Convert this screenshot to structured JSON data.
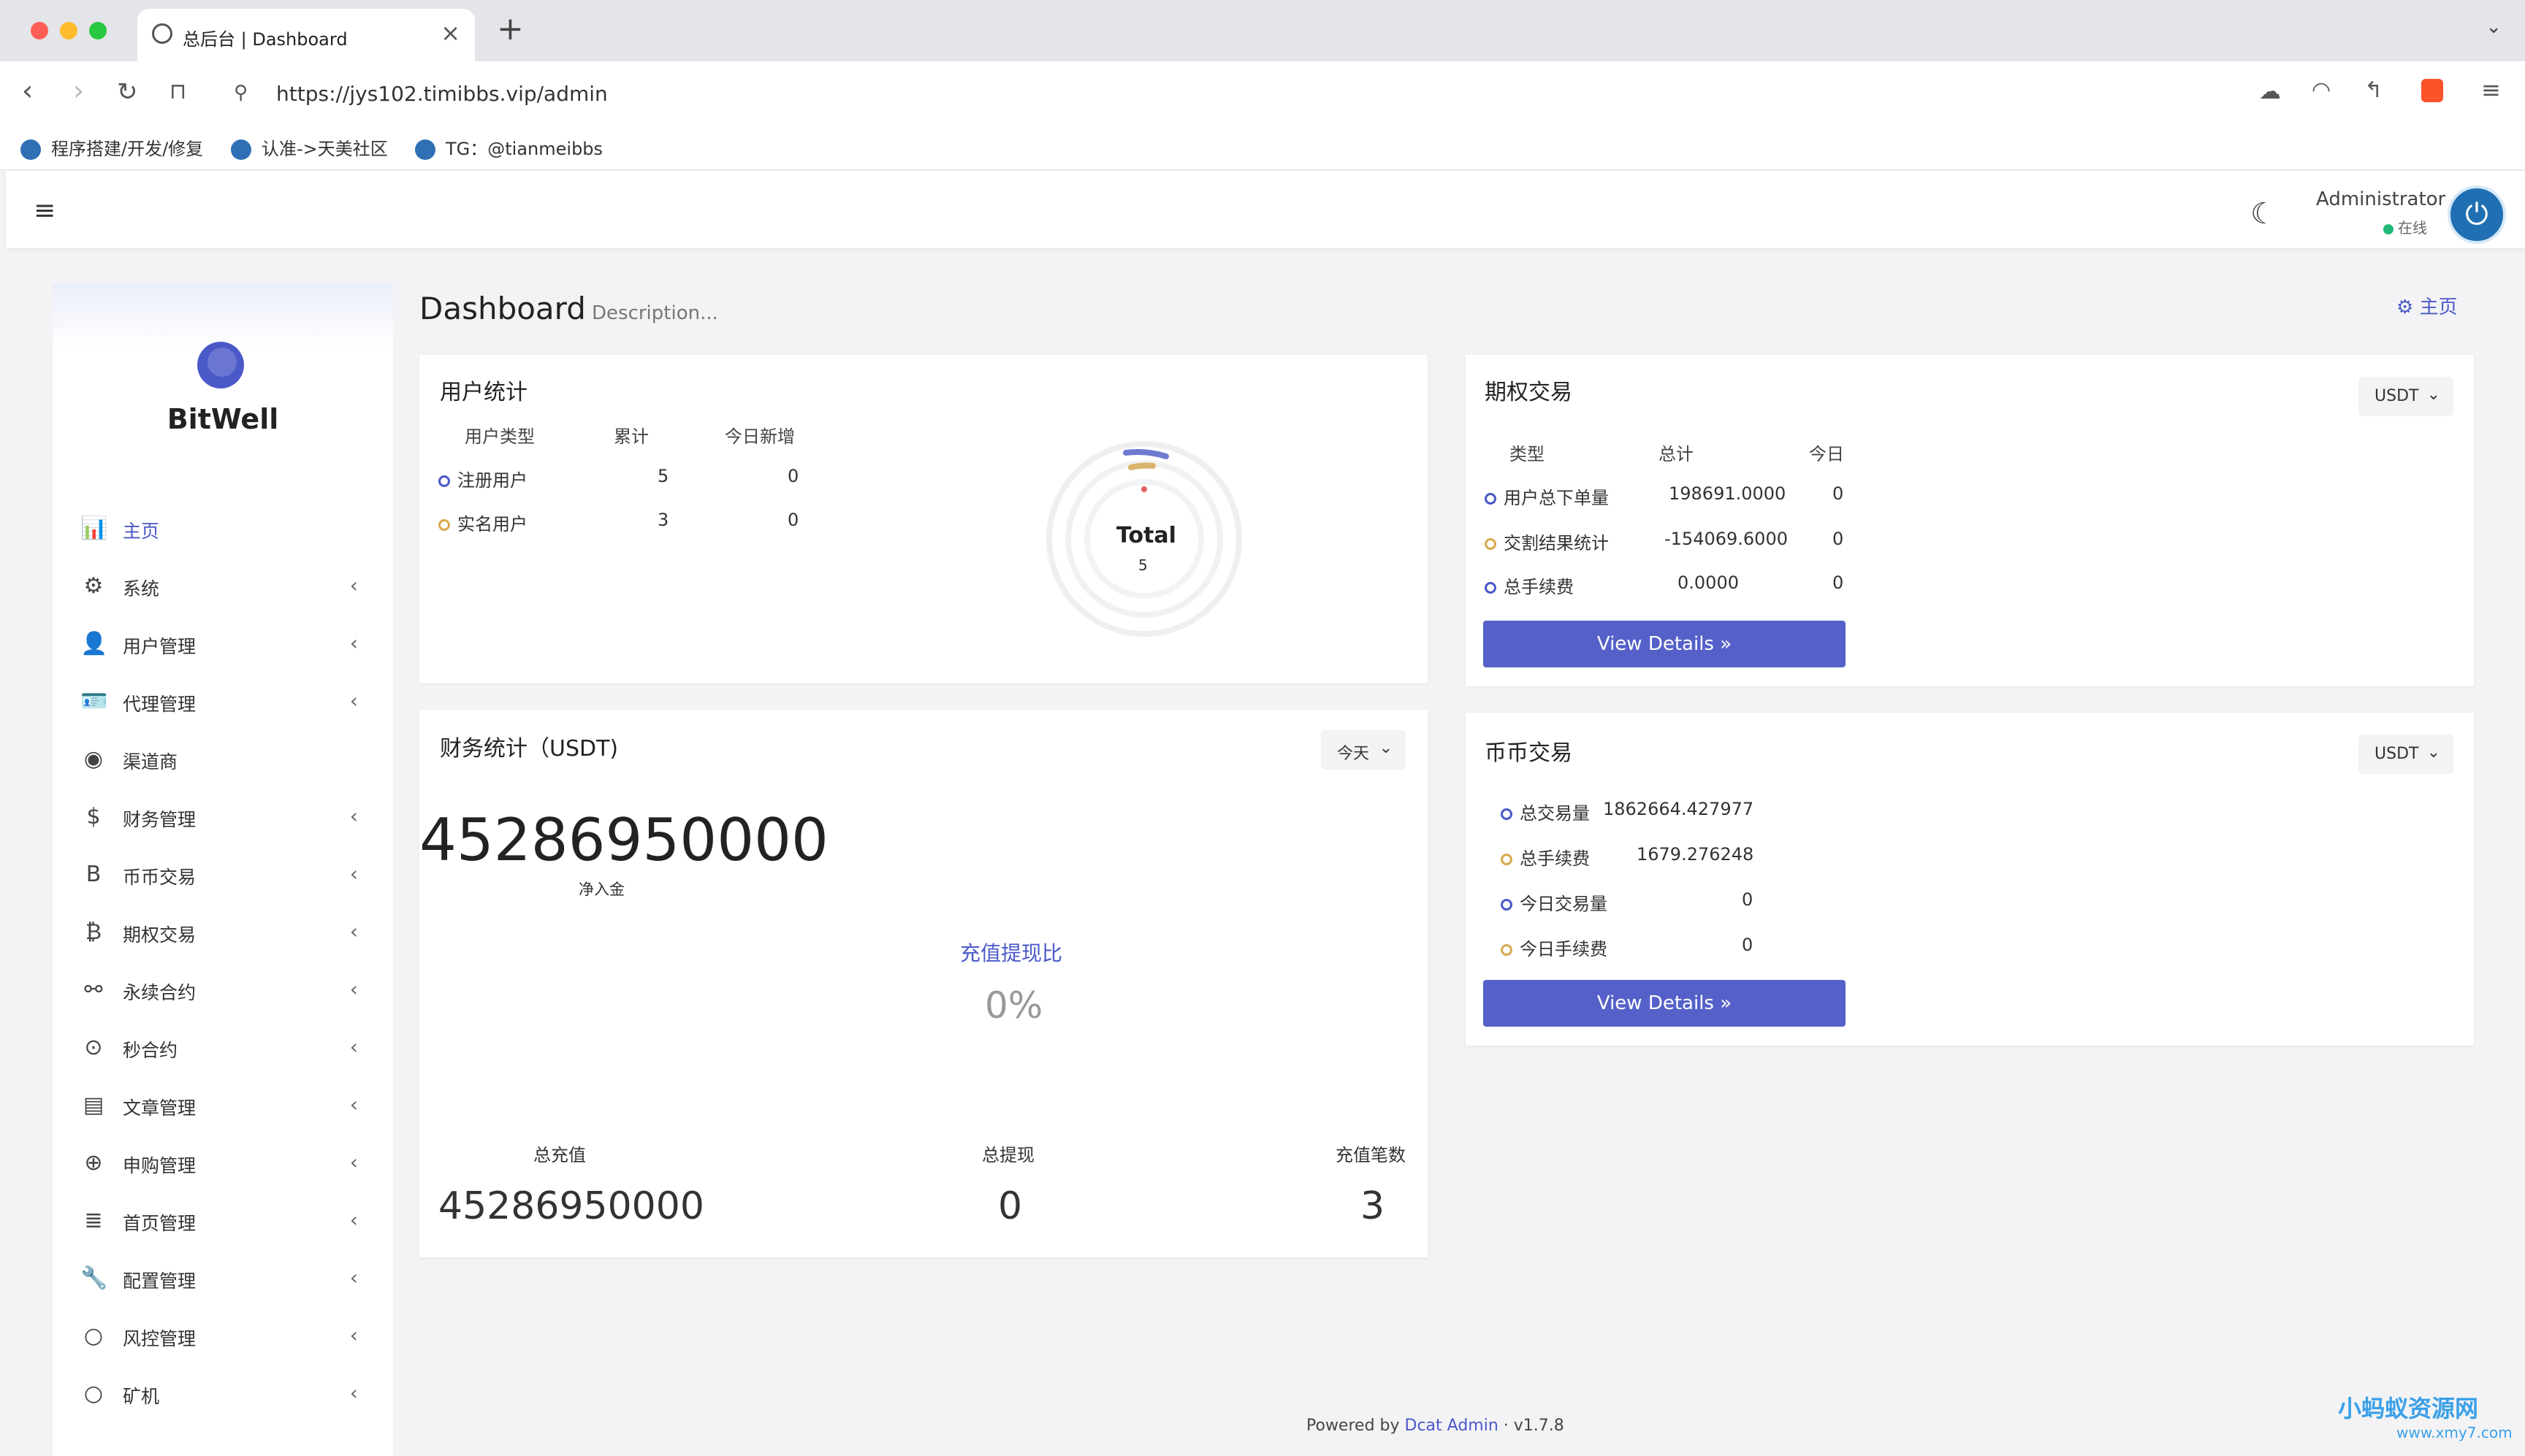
{
  "browser": {
    "tab_title": "总后台 | Dashboard",
    "tab_close": "×",
    "new_tab": "+",
    "url": "https://jys102.timibbs.vip/admin",
    "bookmarks": [
      "程序搭建/开发/修复",
      "认准->天美社区",
      "TG：@tianmeibbs"
    ]
  },
  "header": {
    "menu_icon": "≡",
    "theme_icon": "☾",
    "user_name": "Administrator",
    "user_status": "在线",
    "avatar_icon": "⏻"
  },
  "sidebar": {
    "brand": "BitWell",
    "items": [
      {
        "label": "主页",
        "icon": "bar-chart-icon",
        "glyph": "📊",
        "active": true,
        "arrow": ""
      },
      {
        "label": "系统",
        "icon": "gear-icon",
        "glyph": "⚙",
        "arrow": "‹"
      },
      {
        "label": "用户管理",
        "icon": "user-icon",
        "glyph": "👤",
        "arrow": "‹"
      },
      {
        "label": "代理管理",
        "icon": "id-card-icon",
        "glyph": "🪪",
        "arrow": "‹"
      },
      {
        "label": "渠道商",
        "icon": "user-circle-icon",
        "glyph": "◉",
        "arrow": ""
      },
      {
        "label": "财务管理",
        "icon": "dollar-icon",
        "glyph": "$",
        "arrow": "‹"
      },
      {
        "label": "币币交易",
        "icon": "b-letter-icon",
        "glyph": "B",
        "arrow": "‹"
      },
      {
        "label": "期权交易",
        "icon": "bitcoin-icon",
        "glyph": "₿",
        "arrow": "‹"
      },
      {
        "label": "永续合约",
        "icon": "link-icon",
        "glyph": "⚯",
        "arrow": "‹"
      },
      {
        "label": "秒合约",
        "icon": "target-icon",
        "glyph": "⊙",
        "arrow": "‹"
      },
      {
        "label": "文章管理",
        "icon": "newspaper-icon",
        "glyph": "▤",
        "arrow": "‹"
      },
      {
        "label": "申购管理",
        "icon": "lifebuoy-icon",
        "glyph": "⊕",
        "arrow": "‹"
      },
      {
        "label": "首页管理",
        "icon": "list-icon",
        "glyph": "≣",
        "arrow": "‹"
      },
      {
        "label": "配置管理",
        "icon": "wrench-icon",
        "glyph": "🔧",
        "arrow": "‹"
      },
      {
        "label": "风控管理",
        "icon": "circle-icon",
        "glyph": "○",
        "arrow": "‹"
      },
      {
        "label": "矿机",
        "icon": "circle-icon",
        "glyph": "○",
        "arrow": "‹"
      }
    ]
  },
  "page": {
    "title": "Dashboard",
    "description": "Description...",
    "home_link": "主页"
  },
  "user_stats": {
    "title": "用户统计",
    "headers": [
      "用户类型",
      "累计",
      "今日新增"
    ],
    "rows": [
      {
        "type": "注册用户",
        "total": "5",
        "today": "0",
        "color": "#4a58c8"
      },
      {
        "type": "实名用户",
        "total": "3",
        "today": "0",
        "color": "#d9a94f"
      }
    ],
    "donut_label": "Total",
    "donut_value": "5"
  },
  "options_trade": {
    "title": "期权交易",
    "currency": "USDT",
    "headers": [
      "类型",
      "总计",
      "今日"
    ],
    "rows": [
      {
        "type": "用户总下单量",
        "total": "198691.0000",
        "today": "0"
      },
      {
        "type": "交割结果统计",
        "total": "-154069.6000",
        "today": "0"
      },
      {
        "type": "总手续费",
        "total": "0.0000",
        "today": "0"
      }
    ],
    "button": "View Details »"
  },
  "finance": {
    "title": "财务统计（USDT)",
    "period": "今天",
    "net_value": "45286950000",
    "net_label": "净入金",
    "ratio_label": "充值提现比",
    "ratio_value": "0%",
    "bottom": [
      {
        "label": "总充值",
        "value": "45286950000"
      },
      {
        "label": "总提现",
        "value": "0"
      },
      {
        "label": "充值笔数",
        "value": "3"
      }
    ]
  },
  "coin_trade": {
    "title": "币币交易",
    "currency": "USDT",
    "rows": [
      {
        "label": "总交易量",
        "value": "1862664.427977"
      },
      {
        "label": "总手续费",
        "value": "1679.276248"
      },
      {
        "label": "今日交易量",
        "value": "0"
      },
      {
        "label": "今日手续费",
        "value": "0"
      }
    ],
    "button": "View Details »"
  },
  "footer": {
    "powered": "Powered by",
    "link": "Dcat Admin",
    "version": "·  v1.7.8"
  },
  "watermark": {
    "text": "小蚂蚁资源网",
    "url": "www.xmy7.com"
  }
}
